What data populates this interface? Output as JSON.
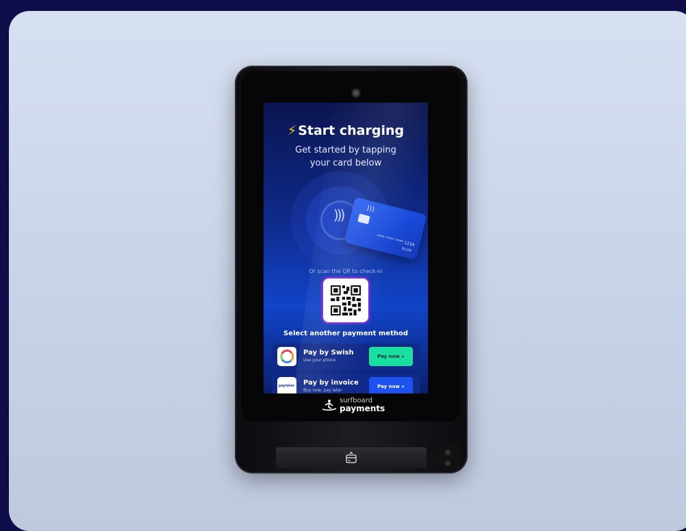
{
  "screen": {
    "bolt": "⚡",
    "title": "Start charging",
    "subtitle": "Get started by tapping\nyour card below",
    "card_number": "**** **** **** 1234",
    "card_expiry": "01/26",
    "qr_hint": "Or scan the QR to check-in",
    "other_method": "Select another payment method",
    "payments": [
      {
        "title": "Pay by Swish",
        "sub": "Use your phone",
        "button": "Pay now »",
        "logo": "swish-logo",
        "button_color": "#19e0a0"
      },
      {
        "title": "Pay by invoice",
        "sub": "Buy now, pay later",
        "button": "Pay now »",
        "logo": "paylater-logo",
        "logo_text": "paylater",
        "button_color": "#1d52f0"
      }
    ]
  },
  "brand": {
    "line1": "surfboard",
    "line2": "payments"
  },
  "colors": {
    "background": "#0f0e4a",
    "stage": "#d7e0f1",
    "accent_green": "#19e0a0",
    "accent_blue": "#1d52f0",
    "qr_border": "#6a2ad8"
  }
}
